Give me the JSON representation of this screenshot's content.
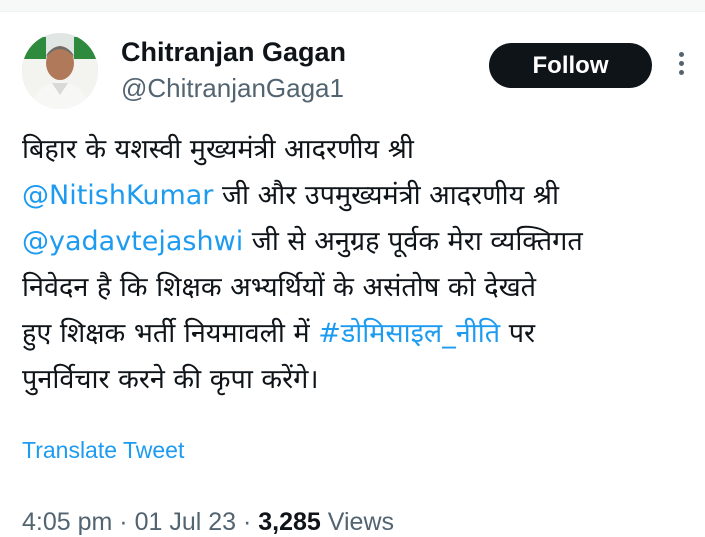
{
  "tweet": {
    "author": {
      "name": "Chitranjan Gagan",
      "handle": "@ChitranjanGaga1"
    },
    "follow_label": "Follow",
    "more_icon": "more-vertical-icon",
    "text": {
      "line1": "बिहार के यशस्वी मुख्यमंत्री आदरणीय श्री",
      "mention1": "@NitishKumar",
      "line2_rest": " जी और उपमुख्यमंत्री आदरणीय श्री",
      "mention2": "@yadavtejashwi",
      "line3_rest": " जी से अनुग्रह पूर्वक मेरा व्यक्तिगत",
      "line4": "निवेदन है कि शिक्षक अभ्यर्थियों के असंतोष को देखते",
      "line5_pre": "हुए शिक्षक भर्ती नियमावली में ",
      "hashtag": "#डोमिसाइल_नीति",
      "line5_post": "  पर",
      "line6": "पुनर्विचार करने की कृपा करेंगे।"
    },
    "translate_label": "Translate Tweet",
    "meta": {
      "time": "4:05 pm",
      "separator": " · ",
      "date": "01 Jul 23",
      "separator2": " · ",
      "views_count": "3,285",
      "views_label": " Views"
    },
    "colors": {
      "link": "#1d9bf0",
      "text": "#0f1419",
      "secondary": "#536471",
      "button": "#0f1419"
    }
  }
}
